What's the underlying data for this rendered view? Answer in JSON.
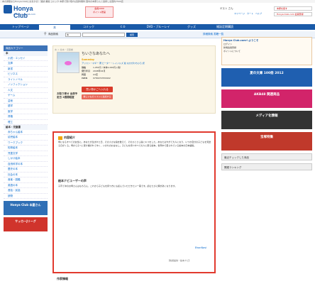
{
  "topbar": "本の通販ならHonya Clubにおまかせ！ 雑誌 書籍 コミック 本屋で受け取れば送料無料 国内の本屋さんと連携し全国約7500店",
  "logo": {
    "name": "Honya Club",
    "url": "www.honyaclub.com"
  },
  "promo": {
    "line1": "会員1000",
    "line2": "ポイント贈呈"
  },
  "user": {
    "greeting": "ゲスト さん",
    "links": "マイページ　カート　ヘルプ"
  },
  "search_buttons": [
    "本屋を探す",
    "Honya Club.com 会員登録"
  ],
  "nav": {
    "tabs": [
      "トップページ",
      "本",
      "コミック",
      "ＣＤ",
      "DVD・ブルーレイ",
      "グッズ",
      "雑誌定期購読"
    ]
  },
  "search": {
    "label": "商品検索",
    "select": "本",
    "placeholder": "",
    "go": "検索",
    "links": "詳細検索 書籍一覧"
  },
  "sidebar": {
    "head": "商品カテゴリー",
    "groups": [
      {
        "title": "本",
        "items": [
          "小説・エッセイ",
          "文庫",
          "新書",
          "ビジネス",
          "ライトノベル",
          "ノンフィクション",
          "人文",
          "ゲーム",
          "芸術",
          "語学",
          "医学",
          "資格",
          "理工"
        ]
      },
      {
        "title": "絵本・児童書",
        "items": [
          "赤ちゃん絵本",
          "幼児絵本",
          "ワークブック",
          "知育絵本",
          "児童文学",
          "しかけ絵本",
          "自然科学の本",
          "歴史の本",
          "社会の本",
          "音楽・図鑑",
          "英語の本",
          "昔話・民話",
          "読物"
        ]
      }
    ],
    "banners": [
      "Honya Club 本屋さん",
      "サッカーJリーグ"
    ]
  },
  "product": {
    "crumbs": "本 ＞ 絵本・児童書",
    "title": "ちいさなあなたへ",
    "subtitle": "Someday",
    "authors": "アリスン・マギー 著 ピーター・レイノルズ 絵 なかがわちひろ 訳",
    "specs": [
      {
        "k": "価格",
        "v": "1,050円（本体1,000円＋税）"
      },
      {
        "k": "発行年月",
        "v": "2008年04月"
      },
      {
        "k": "判型",
        "v": "A4変"
      },
      {
        "k": "ISBN",
        "v": "9784072559902"
      }
    ],
    "ship_note": "お取り寄せ 出荷予定日 2週間程度",
    "cart": "買い物かごへ入れる",
    "wish": "欲しいものリストに追加する"
  },
  "desc": {
    "head": "内容紹介",
    "body": "母になるすべての女性に。あなたが生まれた日、その小さな指を数えて、そのひとさし指にキスをした。あなたはやがて大人になり、いつか自分の子どもを見送る日がくる。母から子へと受け継がれてゆく、いのちのおはなし。子どもを持つすべての人に贈る絵本。世界中で愛されている絵本の日本語版。",
    "rec_head": "絵本ナビユーザーの声",
    "rec_body": "子育て中のお母さんはもちろん、これから子どもを持つ方にも読んでいただきたい一冊です。読むたびに胸が熱くなります。",
    "ehon": "EhonNavi",
    "source": "【情報提供・絵本ナビ】"
  },
  "author_head": "作家情報",
  "right": {
    "login_title": "Honya Club.comへようこそ",
    "login_items": [
      "ログイン",
      "新規会員登録",
      "ポイントについて"
    ],
    "banners": [
      "夏の文庫 100冊 2012",
      "AKB48 関連商品",
      "メディア化情報",
      "宝塚特集"
    ],
    "minis": [
      "最近チェックした商品",
      "関連ランキング"
    ]
  },
  "colors": {
    "brand": "#1a5aa8",
    "accent": "#e13a2e"
  }
}
